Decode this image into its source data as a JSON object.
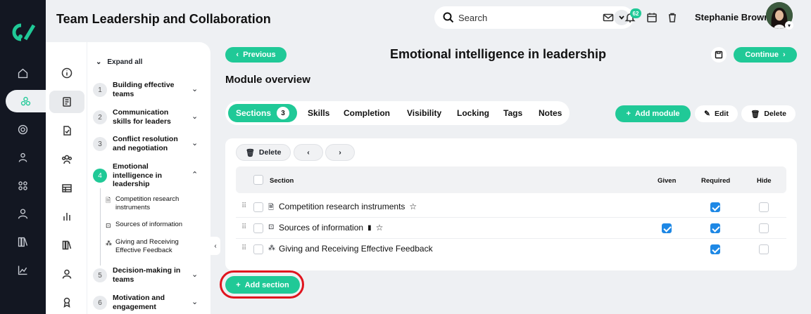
{
  "app": {
    "title": "Team Leadership and Collaboration"
  },
  "search": {
    "placeholder": "Search"
  },
  "topbar": {
    "notification_count": "62",
    "user_name": "Stephanie Brown"
  },
  "rail": {
    "items": [
      "home-icon",
      "course-icon",
      "target-icon",
      "users-icon",
      "grid-icon",
      "user-icon",
      "library-icon",
      "analytics-icon"
    ]
  },
  "panel": {
    "items": [
      "info-icon",
      "book-icon",
      "test-icon",
      "people-icon",
      "table-icon",
      "chart-icon",
      "library-icon",
      "profile-icon",
      "certificate-icon"
    ]
  },
  "tree": {
    "expand_all": "Expand all",
    "modules": [
      {
        "num": "1",
        "title": "Building effective teams"
      },
      {
        "num": "2",
        "title": "Communication skills for leaders"
      },
      {
        "num": "3",
        "title": "Conflict resolution and negotiation"
      },
      {
        "num": "4",
        "title": "Emotional intelligence in leadership"
      },
      {
        "num": "5",
        "title": "Decision-making in teams"
      },
      {
        "num": "6",
        "title": "Motivation and engagement"
      }
    ],
    "subitems": [
      {
        "title": "Competition research instruments"
      },
      {
        "title": "Sources of information"
      },
      {
        "title": "Giving and Receiving Effective Feedback"
      }
    ]
  },
  "nav": {
    "previous": "Previous",
    "continue": "Continue"
  },
  "page": {
    "title": "Emotional intelligence in leadership",
    "overview": "Module overview"
  },
  "tabs": [
    {
      "label": "Sections",
      "count": "3"
    },
    {
      "label": "Skills"
    },
    {
      "label": "Completion"
    },
    {
      "label": "Visibility"
    },
    {
      "label": "Locking"
    },
    {
      "label": "Tags"
    },
    {
      "label": "Notes"
    }
  ],
  "actions": {
    "add_module": "Add module",
    "edit": "Edit",
    "delete": "Delete"
  },
  "table": {
    "delete_label": "Delete",
    "headers": {
      "section": "Section",
      "given": "Given",
      "required": "Required",
      "hide": "Hide"
    },
    "rows": [
      {
        "name": "Competition research instruments",
        "given": false,
        "required": true,
        "hide": false
      },
      {
        "name": "Sources of information",
        "given": true,
        "required": true,
        "hide": false
      },
      {
        "name": "Giving and Receiving Effective Feedback",
        "given": false,
        "required": true,
        "hide": false
      }
    ]
  },
  "add_section": "Add section",
  "colors": {
    "accent": "#20c997",
    "rail": "#131722",
    "check": "#1e88e5",
    "highlight": "#e0141e"
  }
}
